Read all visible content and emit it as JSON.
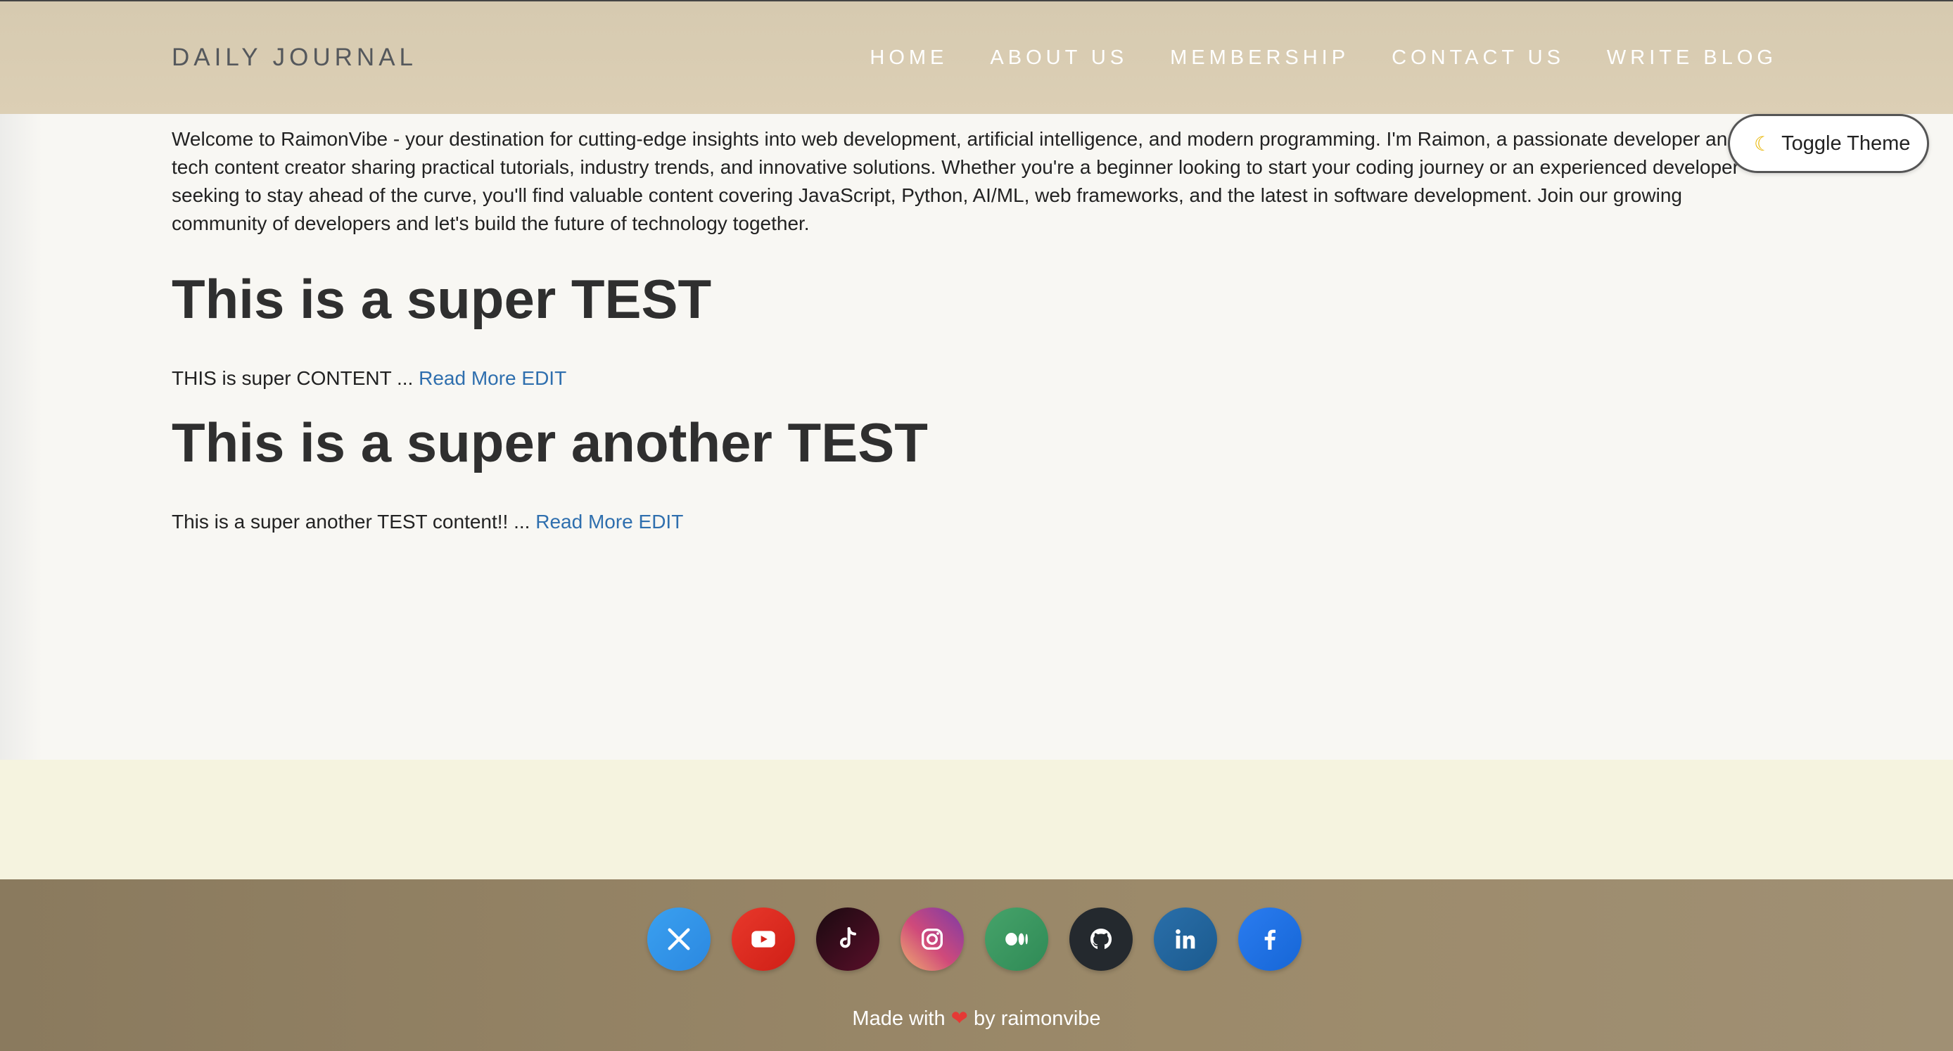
{
  "header": {
    "brand": "DAILY JOURNAL",
    "nav": [
      "HOME",
      "ABOUT US",
      "MEMBERSHIP",
      "CONTACT US",
      "WRITE BLOG"
    ]
  },
  "toggle": {
    "icon": "moon-icon",
    "label": "Toggle Theme"
  },
  "intro": "Welcome to RaimonVibe - your destination for cutting-edge insights into web development, artificial intelligence, and modern programming. I'm Raimon, a passionate developer and tech content creator sharing practical tutorials, industry trends, and innovative solutions. Whether you're a beginner looking to start your coding journey or an experienced developer seeking to stay ahead of the curve, you'll find valuable content covering JavaScript, Python, AI/ML, web frameworks, and the latest in software development. Join our growing community of developers and let's build the future of technology together.",
  "posts": [
    {
      "title": "This is a super TEST",
      "excerpt": "THIS is super CONTENT ...",
      "read_more": "Read More",
      "edit": "EDIT"
    },
    {
      "title": "This is a super another TEST",
      "excerpt": "This is a super another TEST content!! ...",
      "read_more": "Read More",
      "edit": "EDIT"
    }
  ],
  "footer": {
    "socials": [
      {
        "name": "x-icon",
        "color": "#1d9bf0"
      },
      {
        "name": "youtube-icon",
        "color": "#e0251b"
      },
      {
        "name": "tiktok-icon",
        "color": "#2a0a14"
      },
      {
        "name": "instagram-icon",
        "color": "#c13584"
      },
      {
        "name": "medium-icon",
        "color": "#3f9a63"
      },
      {
        "name": "github-icon",
        "color": "#24292e"
      },
      {
        "name": "linkedin-icon",
        "color": "#1e6aa8"
      },
      {
        "name": "facebook-icon",
        "color": "#1877f2"
      }
    ],
    "credit_prefix": "Made with",
    "credit_suffix": "by raimonvibe"
  },
  "colors": {
    "header_bg": "#dccfb5",
    "page_bg": "#f8f7f3",
    "band_bg": "#f5f3df",
    "footer_bg": "#9c8a6a",
    "link": "#2f6fae"
  }
}
